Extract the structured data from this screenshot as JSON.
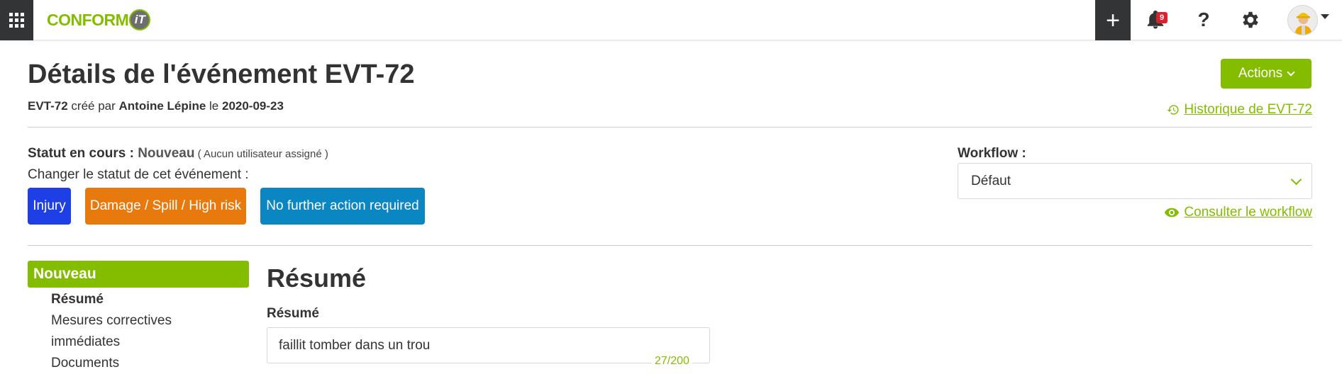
{
  "topbar": {
    "logo_text": "CONFORM",
    "logo_badge": "iT",
    "notifications_count": "9",
    "help_symbol": "?"
  },
  "header": {
    "title": "Détails de l'événement EVT-72",
    "meta": {
      "id": "EVT-72",
      "created_by_text": " créé par ",
      "author": "Antoine Lépine",
      "on_text": " le ",
      "date": "2020-09-23"
    },
    "actions_label": "Actions",
    "history_link": "Historique de EVT-72"
  },
  "status": {
    "label": "Statut en cours : ",
    "value": "Nouveau",
    "assignee_note": " ( Aucun utilisateur assigné )",
    "change_label": "Changer le statut de cet événement :",
    "buttons": [
      {
        "label": "Injury",
        "color": "#1e3fe6"
      },
      {
        "label": "Damage / Spill / High risk",
        "color": "#e87a0d"
      },
      {
        "label": "No further action required",
        "color": "#0a86c2"
      }
    ]
  },
  "workflow": {
    "label": "Workflow :",
    "selected": "Défaut",
    "view_link": "Consulter le workflow"
  },
  "nav": {
    "header": "Nouveau",
    "items": [
      {
        "label": "Résumé",
        "active": true
      },
      {
        "label": "Mesures correctives",
        "active": false
      },
      {
        "label": "immédiates",
        "active": false
      },
      {
        "label": "Documents",
        "active": false
      }
    ]
  },
  "main": {
    "section_title": "Résumé",
    "summary_label": "Résumé",
    "summary_value": "faillit tomber dans un trou",
    "summary_counter": "27/200"
  },
  "colors": {
    "accent": "#84bd00",
    "dark": "#333436"
  }
}
